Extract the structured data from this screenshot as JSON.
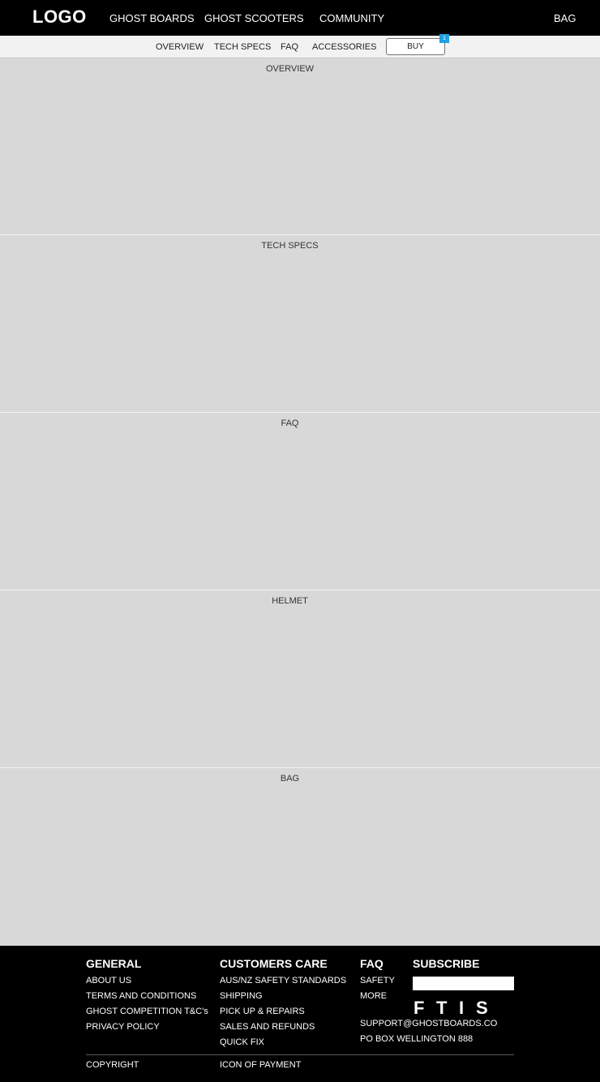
{
  "header": {
    "logo": "LOGO",
    "nav": [
      "GHOST BOARDS",
      "GHOST SCOOTERS",
      "COMMUNITY"
    ],
    "bag": "BAG"
  },
  "subnav": {
    "items": [
      "OVERVIEW",
      "TECH SPECS",
      "FAQ",
      "ACCESSORIES"
    ],
    "buy": "BUY",
    "badge": "1"
  },
  "sections": [
    "OVERVIEW",
    "TECH SPECS",
    "FAQ",
    "HELMET",
    "BAG"
  ],
  "footer": {
    "general": {
      "title": "GENERAL",
      "links": [
        "ABOUT US",
        "TERMS AND CONDITIONS",
        "GHOST COMPETITION T&C's",
        "PRIVACY POLICY"
      ]
    },
    "care": {
      "title": "CUSTOMERS CARE",
      "links": [
        "AUS/NZ SAFETY STANDARDS",
        "SHIPPING",
        "PICK UP & REPAIRS",
        "SALES AND REFUNDS",
        "QUICK FIX"
      ]
    },
    "faq": {
      "title": "FAQ",
      "links": [
        "SAFETY",
        "MORE"
      ]
    },
    "subscribe": {
      "title": "SUBSCRIBE",
      "email_value": "",
      "social": [
        "F",
        "T",
        "I",
        "S"
      ],
      "email": "SUPPORT@GHOSTBOARDS.CO",
      "address": "PO BOX WELLINGTON 888"
    },
    "copyright": "COPYRIGHT",
    "payment": "ICON OF PAYMENT"
  },
  "colors": {
    "header_bg": "#000000",
    "subnav_bg": "#f2f2f2",
    "section_bg": "#d8d8d8",
    "badge": "#1ea0e0"
  }
}
